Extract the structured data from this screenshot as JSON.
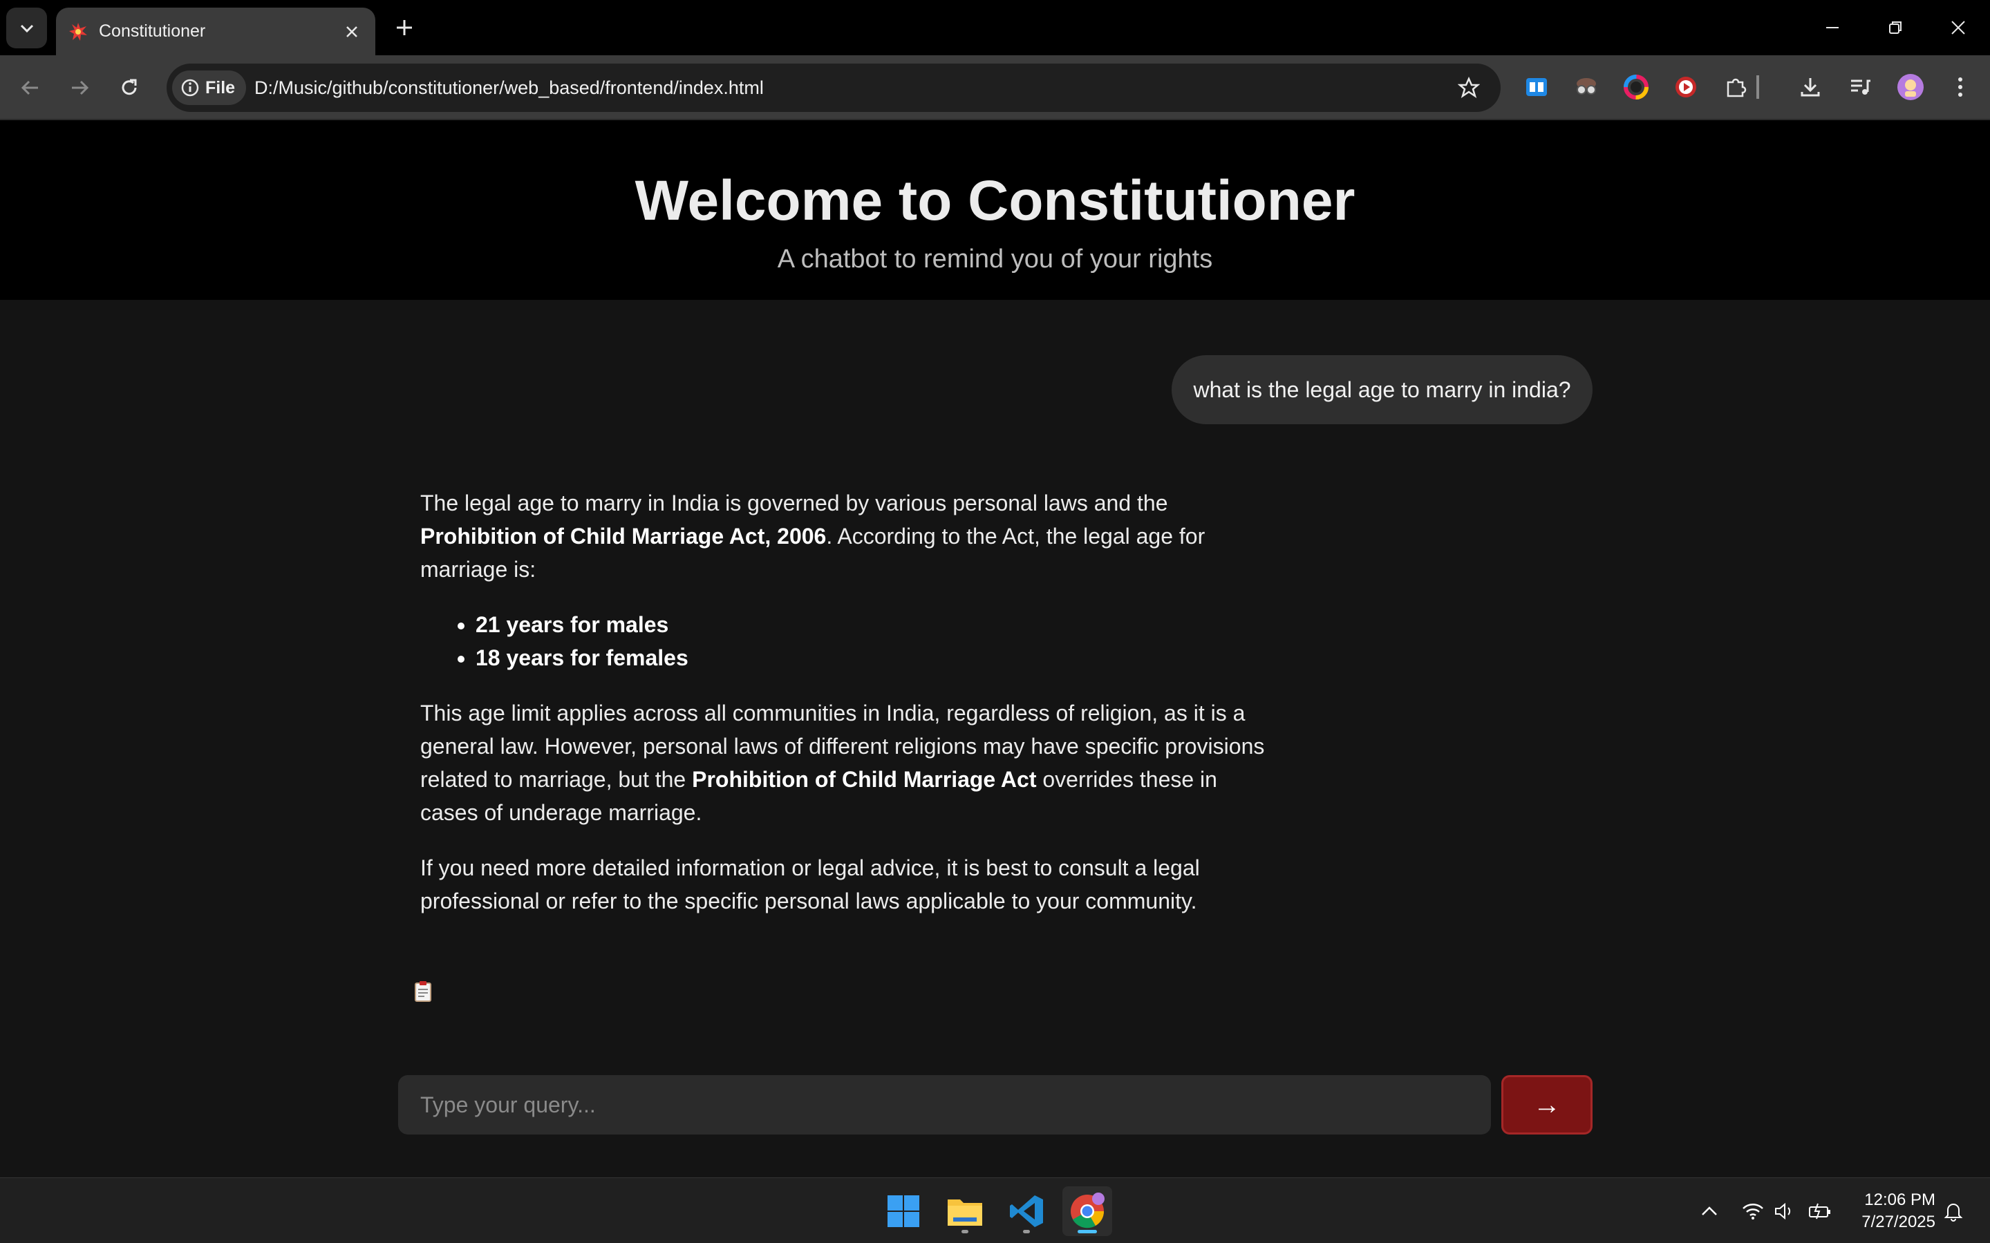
{
  "browser": {
    "tab": {
      "title": "Constitutioner",
      "favicon": "explosion-icon"
    },
    "omnibox": {
      "site_chip": "File",
      "url": "D:/Music/github/constitutioner/web_based/frontend/index.html"
    }
  },
  "header": {
    "title": "Welcome to Constitutioner",
    "subtitle": "A chatbot to remind you of your rights"
  },
  "chat": {
    "user_message": "what is the legal age to marry in india?",
    "bot_message": {
      "p1_a": "The legal age to marry in India is governed by various personal laws and the ",
      "p1_bold": "Prohibition of Child Marriage Act, 2006",
      "p1_b": ". According to the Act, the legal age for marriage is:",
      "list": [
        "21 years for males",
        "18 years for females"
      ],
      "p2_a": "This age limit applies across all communities in India, regardless of religion, as it is a general law. However, personal laws of different religions may have specific provisions related to marriage, but the ",
      "p2_bold": "Prohibition of Child Marriage Act",
      "p2_b": " overrides these in cases of underage marriage.",
      "p3": "If you need more detailed information or legal advice, it is best to consult a legal professional or refer to the specific personal laws applicable to your community."
    }
  },
  "input": {
    "placeholder": "Type your query...",
    "send_label": "→"
  },
  "taskbar": {
    "time": "12:06 PM",
    "date": "7/27/2025",
    "apps": [
      "start",
      "file-explorer",
      "vscode",
      "chrome"
    ]
  },
  "colors": {
    "send_button": "#7c1414",
    "page_bg": "#141414",
    "header_bg": "#000000"
  }
}
